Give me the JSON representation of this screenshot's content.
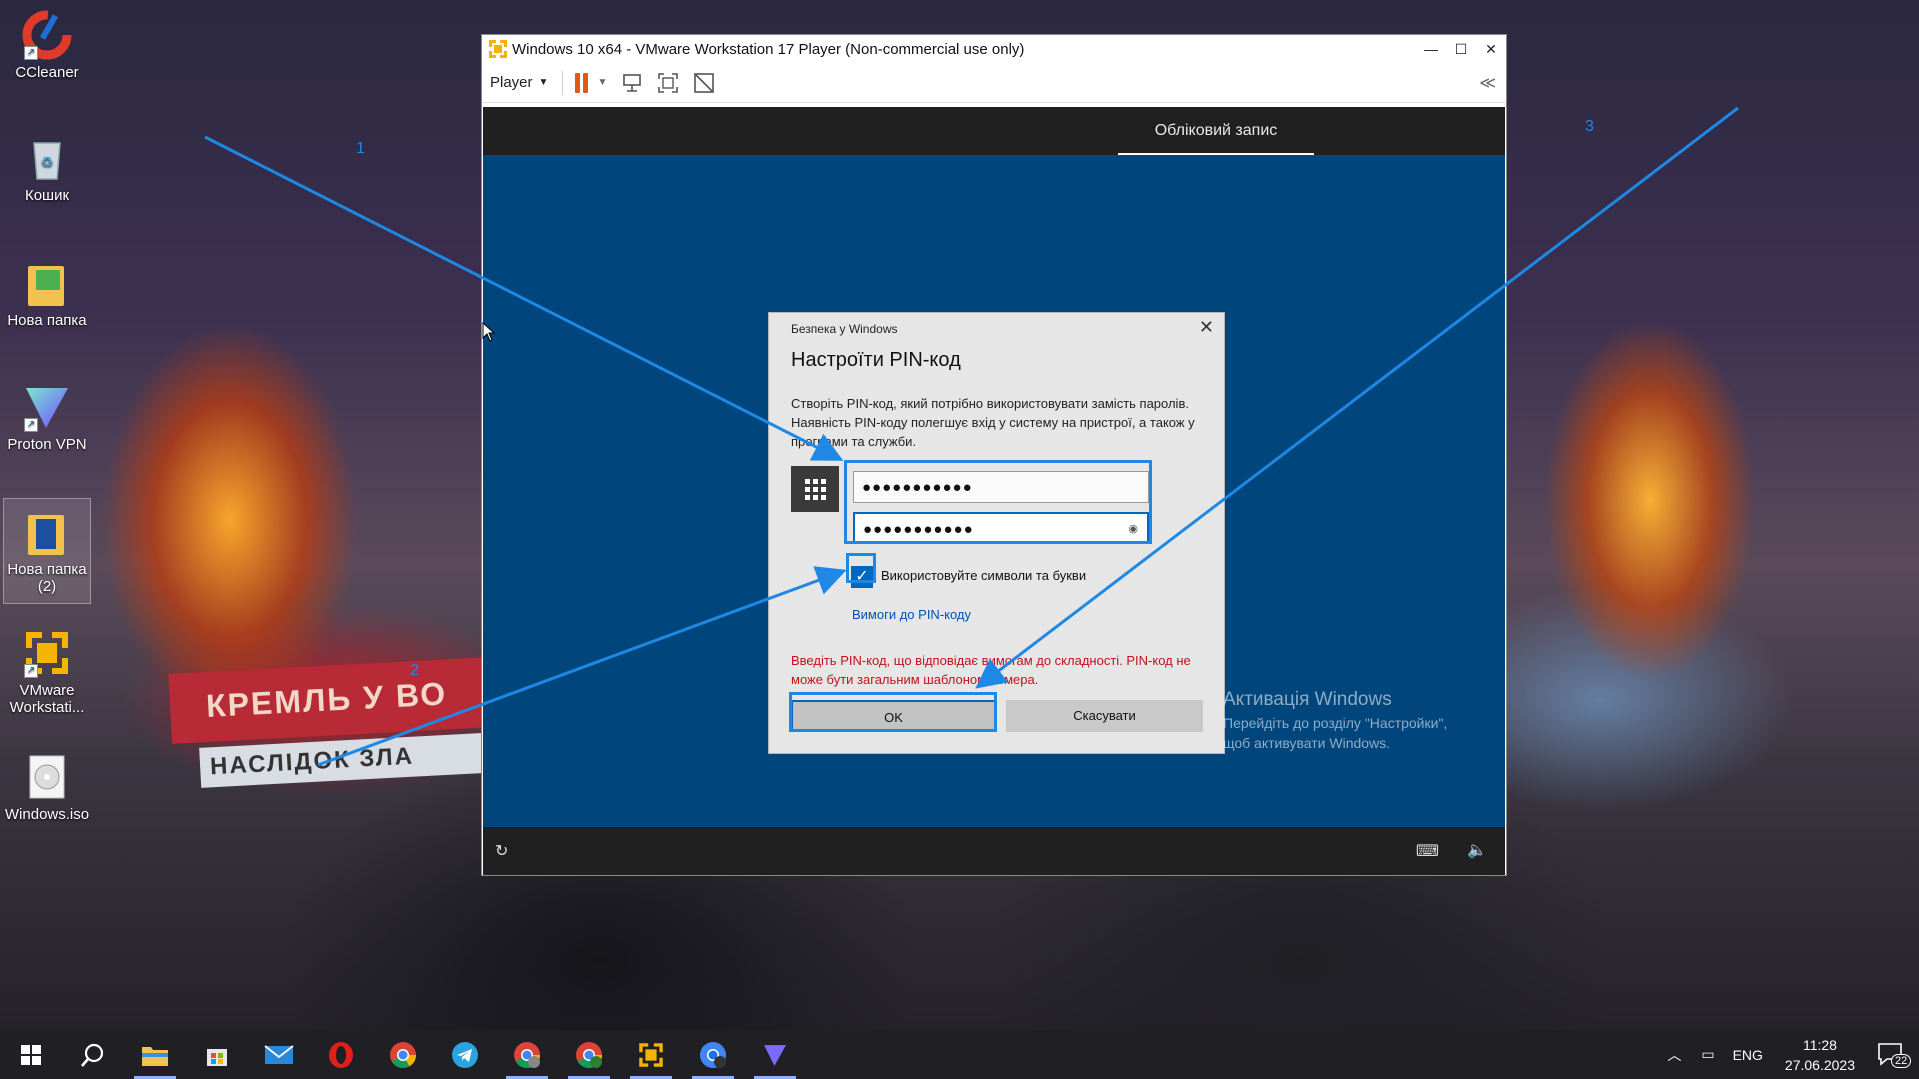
{
  "desktop": {
    "icons": [
      {
        "label": "CCleaner"
      },
      {
        "label": "Кошик"
      },
      {
        "label": "Нова папка"
      },
      {
        "label": "Proton VPN"
      },
      {
        "label": "Нова папка (2)"
      },
      {
        "label": "VMware Workstati..."
      },
      {
        "label": "Windows.iso"
      }
    ],
    "wallpaper_text": [
      "КРЕМЛЬ У ВО",
      "НАСЛІДОК ЗЛА"
    ]
  },
  "vmware": {
    "title": "Windows 10 x64 - VMware Workstation 17 Player (Non-commercial use only)",
    "toolbar": {
      "player_menu": "Player"
    },
    "window_controls": {
      "minimize": "—",
      "maximize": "☐",
      "close": "✕"
    }
  },
  "oobe": {
    "tab": "Обліковий запис"
  },
  "dialog": {
    "caption": "Безпека у Windows",
    "title": "Настроїти PIN-код",
    "description": "Створіть PIN-код, який потрібно використовувати замість паролів. Наявність PIN-коду полегшує вхід у систему на пристрої, а також у програми та служби.",
    "pin_value": "●●●●●●●●●●●",
    "confirm_value": "●●●●●●●●●●●",
    "checkbox_label": "Використовуйте символи та букви",
    "checkbox_checked": true,
    "requirements_link": "Вимоги до PIN-коду",
    "error": "Введіть PIN-код, що відповідає вимогам до складності. PIN-код не може бути загальним шаблоном номера.",
    "ok_label": "OK",
    "cancel_label": "Скасувати"
  },
  "activation": {
    "title": "Активація Windows",
    "line1": "Перейдіть до розділу \"Настройки\",",
    "line2": "щоб активувати Windows."
  },
  "annotations": {
    "labels": [
      "1",
      "2",
      "3"
    ],
    "color": "#1e88e5"
  },
  "taskbar": {
    "language": "ENG",
    "time": "11:28",
    "date": "27.06.2023",
    "notifications": "22",
    "apps": [
      "start-button",
      "search",
      "file-explorer",
      "microsoft-store",
      "mail",
      "opera",
      "chrome",
      "telegram",
      "chrome-profile-c",
      "chrome-profile-j",
      "vmware",
      "chrome-profile-2",
      "proton-vpn"
    ]
  },
  "colors": {
    "accent": "#0067c0",
    "oobe_bg": "#00457c",
    "error": "#c4101a"
  }
}
